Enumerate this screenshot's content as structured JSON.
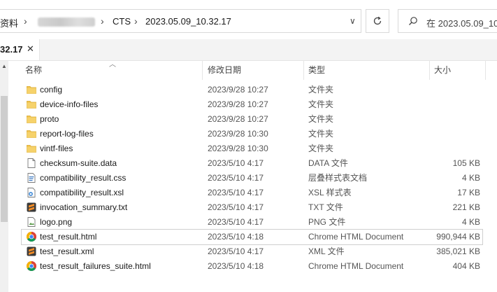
{
  "address": {
    "crumb_prefix": "资料",
    "crumbs": [
      "CTS",
      "2023.05.09_10.32.17"
    ],
    "search_placeholder": "在 2023.05.09_10."
  },
  "tab": {
    "label": "32.17",
    "close": "✕"
  },
  "columns": {
    "name": "名称",
    "date": "修改日期",
    "type": "类型",
    "size": "大小"
  },
  "rows": [
    {
      "name": "config",
      "date": "2023/9/28 10:27",
      "type": "文件夹",
      "size": "",
      "icon": "folder-icon"
    },
    {
      "name": "device-info-files",
      "date": "2023/9/28 10:27",
      "type": "文件夹",
      "size": "",
      "icon": "folder-icon"
    },
    {
      "name": "proto",
      "date": "2023/9/28 10:27",
      "type": "文件夹",
      "size": "",
      "icon": "folder-icon"
    },
    {
      "name": "report-log-files",
      "date": "2023/9/28 10:30",
      "type": "文件夹",
      "size": "",
      "icon": "folder-icon"
    },
    {
      "name": "vintf-files",
      "date": "2023/9/28 10:30",
      "type": "文件夹",
      "size": "",
      "icon": "folder-icon"
    },
    {
      "name": "checksum-suite.data",
      "date": "2023/5/10 4:17",
      "type": "DATA 文件",
      "size": "105 KB",
      "icon": "file-icon"
    },
    {
      "name": "compatibility_result.css",
      "date": "2023/5/10 4:17",
      "type": "层叠样式表文档",
      "size": "4 KB",
      "icon": "css-file-icon"
    },
    {
      "name": "compatibility_result.xsl",
      "date": "2023/5/10 4:17",
      "type": "XSL 样式表",
      "size": "17 KB",
      "icon": "xsl-file-icon"
    },
    {
      "name": "invocation_summary.txt",
      "date": "2023/5/10 4:17",
      "type": "TXT 文件",
      "size": "221 KB",
      "icon": "sublime-icon"
    },
    {
      "name": "logo.png",
      "date": "2023/5/10 4:17",
      "type": "PNG 文件",
      "size": "4 KB",
      "icon": "image-file-icon"
    },
    {
      "name": "test_result.html",
      "date": "2023/5/10 4:18",
      "type": "Chrome HTML Document",
      "size": "990,944 KB",
      "icon": "chrome-icon",
      "selected": true
    },
    {
      "name": "test_result.xml",
      "date": "2023/5/10 4:17",
      "type": "XML 文件",
      "size": "385,021 KB",
      "icon": "sublime-icon"
    },
    {
      "name": "test_result_failures_suite.html",
      "date": "2023/5/10 4:18",
      "type": "Chrome HTML Document",
      "size": "404 KB",
      "icon": "chrome-icon"
    }
  ],
  "colors": {
    "folder": "#f0c14b",
    "sublime": "#f28c26",
    "chrome_red": "#db4437",
    "chrome_green": "#0f9d58",
    "chrome_yellow": "#f4b400",
    "chrome_blue": "#4285f4"
  }
}
